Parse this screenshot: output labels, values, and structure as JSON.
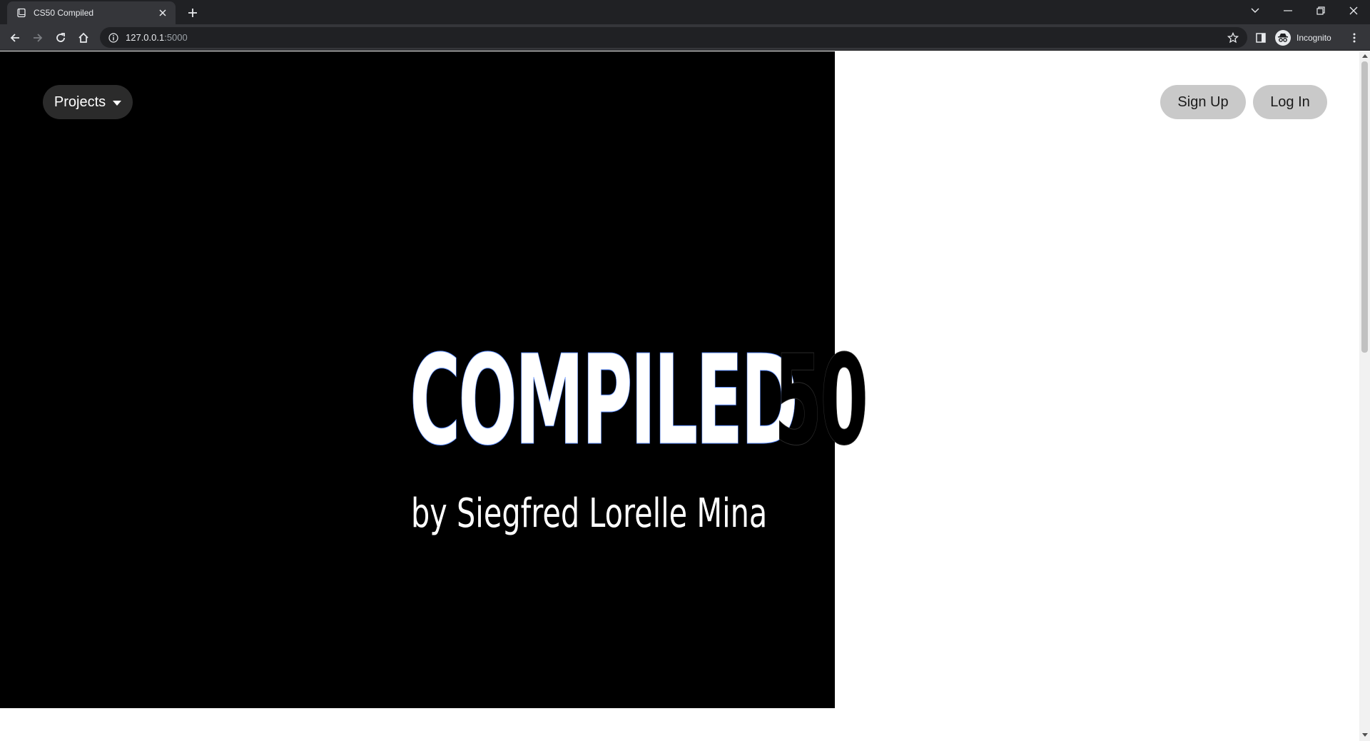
{
  "browser": {
    "tab_title": "CS50 Compiled",
    "url_host": "127.0.0.1",
    "url_port": ":5000",
    "profile_label": "Incognito"
  },
  "nav": {
    "projects_label": "Projects",
    "signup_label": "Sign Up",
    "login_label": "Log In"
  },
  "hero": {
    "title_part1": "COMPILED",
    "title_part2": "50",
    "subtitle": "by Siegfred Lorelle Mina"
  },
  "colors": {
    "hero_bg": "#000000",
    "page_bg": "#ffffff",
    "projects_btn_bg": "#2b2b2b",
    "auth_btn_bg": "#c9c9c9"
  }
}
